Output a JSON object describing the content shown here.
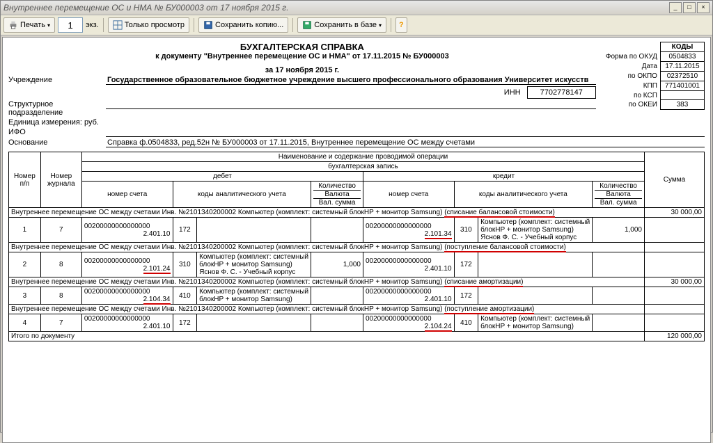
{
  "window": {
    "title": "Внутреннее перемещение ОС и НМА № БУ000003 от 17 ноября 2015 г."
  },
  "toolbar": {
    "print": "Печать",
    "copies": "1",
    "copies_suffix": "экз.",
    "preview": "Только просмотр",
    "save_copy": "Сохранить копию...",
    "save_db": "Сохранить в базе"
  },
  "doc": {
    "title": "БУХГАЛТЕРСКАЯ СПРАВКА",
    "subtitle": "к документу \"Внутреннее перемещение ОС и НМА\" от 17.11.2015 № БУ000003",
    "date_line": "за 17 ноября 2015 г.",
    "org_label": "Учреждение",
    "org": "Государственное образовательное бюджетное учреждение высшего профессионального образования  Университет искусств",
    "subdiv_label": "Структурное подразделение",
    "unit_label": "Единица измерения: руб.",
    "ifo_label": "ИФО",
    "basis_label": "Основание",
    "basis": "Справка ф.0504833, ред.52н № БУ000003 от 17.11.2015, Внутреннее перемещение ОС между счетами",
    "inn_label": "ИНН",
    "inn": "7702778147"
  },
  "codes": {
    "header": "КОДЫ",
    "okud_l": "Форма по ОКУД",
    "okud": "0504833",
    "date_l": "Дата",
    "date": "17.11.2015",
    "okpo_l": "по ОКПО",
    "okpo": "02372510",
    "kpp_l": "КПП",
    "kpp": "771401001",
    "ksp_l": "по КСП",
    "ksp": "",
    "okei_l": "по ОКЕИ",
    "okei": "383"
  },
  "thead": {
    "col_np": "Номер п/п",
    "col_journal": "Номер журнала",
    "op_name": "Наименование и содержание проводимой операции",
    "entry": "бухгалтерская запись",
    "debit": "дебет",
    "credit": "кредит",
    "acct": "номер счета",
    "analytics": "коды аналитического учета",
    "qty": "Количество",
    "currency": "Валюта",
    "val_sum": "Вал. сумма",
    "sum": "Сумма"
  },
  "groups": [
    {
      "text_prefix": "Внутреннее перемещение ОС между счетами Инв. №2101340200002 Компьютер (комплект: системный блокHP + монитор Samsung) ",
      "text_red": "(списание балансовой стоимости)",
      "sum": "30 000,00",
      "row": {
        "np": "1",
        "jr": "7",
        "d_acc": "00200000000000000",
        "d_sub": "2.401.10",
        "d_code": "172",
        "d_desc": "",
        "d_qty": "",
        "c_acc": "00200000000000000",
        "c_sub": "2.101.34",
        "c_sub_red": true,
        "c_code": "310",
        "c_desc": "Компьютер (комплект: системный блокHP + монитор Samsung)\nЯснов Ф. С. - Учебный корпус",
        "c_qty": "1,000"
      }
    },
    {
      "text_prefix": "Внутреннее перемещение ОС между счетами Инв. №2101340200002 Компьютер (комплект: системный блокHP + монитор Samsung) ",
      "text_red": "(поступление балансовой стоимости)",
      "sum": "",
      "row": {
        "np": "2",
        "jr": "8",
        "d_acc": "00200000000000000",
        "d_sub": "2.101.24",
        "d_sub_red": true,
        "d_code": "310",
        "d_desc": "Компьютер (комплект: системный блокHP + монитор Samsung)\nЯснов Ф. С. - Учебный корпус",
        "d_qty": "1,000",
        "c_acc": "00200000000000000",
        "c_sub": "2.401.10",
        "c_code": "172",
        "c_desc": "",
        "c_qty": ""
      }
    },
    {
      "text_prefix": "Внутреннее перемещение ОС между счетами Инв. №2101340200002 Компьютер (комплект: системный блокHP + монитор Samsung) ",
      "text_red": "(списание амортизации)",
      "sum": "30 000,00",
      "row": {
        "np": "3",
        "jr": "8",
        "d_acc": "00200000000000000",
        "d_sub": "2.104.34",
        "d_sub_red": true,
        "d_code": "410",
        "d_desc": "Компьютер (комплект: системный блокHP + монитор Samsung)",
        "d_qty": "",
        "c_acc": "00200000000000000",
        "c_sub": "2.401.10",
        "c_code": "172",
        "c_desc": "",
        "c_qty": ""
      }
    },
    {
      "text_prefix": "Внутреннее перемещение ОС между счетами Инв. №2101340200002 Компьютер (комплект: системный блокHP + монитор Samsung) ",
      "text_red": "(поступление амортизации)",
      "sum": "",
      "row": {
        "np": "4",
        "jr": "7",
        "d_acc": "00200000000000000",
        "d_sub": "2.401.10",
        "d_code": "172",
        "d_desc": "",
        "d_qty": "",
        "c_acc": "00200000000000000",
        "c_sub": "2.104.24",
        "c_sub_red": true,
        "c_code": "410",
        "c_desc": "Компьютер (комплект: системный блокHP + монитор Samsung)",
        "c_qty": ""
      }
    }
  ],
  "footer": {
    "label": "Итого по документу",
    "total": "120 000,00"
  }
}
